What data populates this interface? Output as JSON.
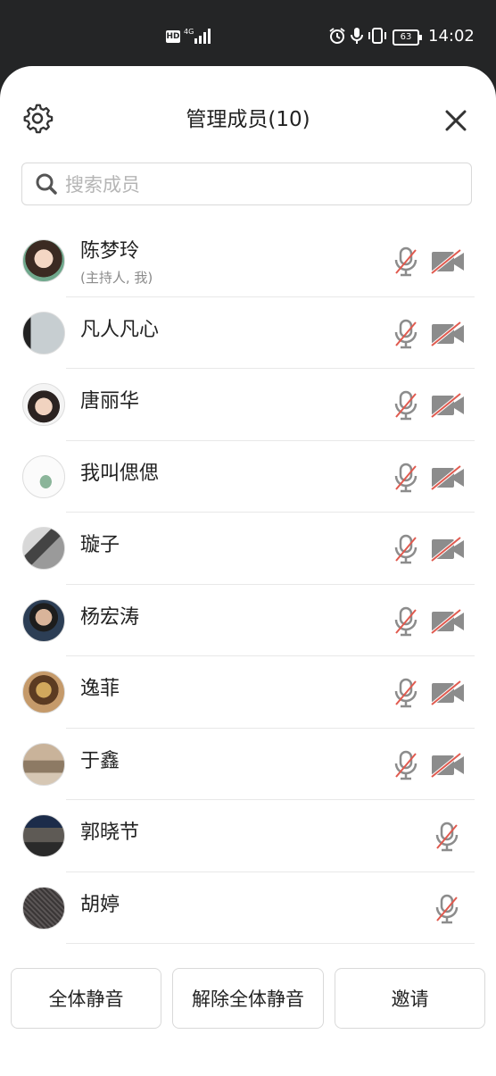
{
  "status_bar": {
    "hd": "HD",
    "network": "4G",
    "battery": "63",
    "time": "14:02"
  },
  "header": {
    "title": "管理成员(10)"
  },
  "search": {
    "placeholder": "搜索成员"
  },
  "members": [
    {
      "name": "陈梦玲",
      "role": "(主持人, 我)",
      "mic": "muted",
      "camera": "off"
    },
    {
      "name": "凡人凡心",
      "mic": "muted",
      "camera": "off"
    },
    {
      "name": "唐丽华",
      "mic": "muted",
      "camera": "off"
    },
    {
      "name": "我叫偲偲",
      "mic": "muted",
      "camera": "off"
    },
    {
      "name": "璇子",
      "mic": "muted",
      "camera": "off"
    },
    {
      "name": "杨宏涛",
      "mic": "muted",
      "camera": "off"
    },
    {
      "name": "逸菲",
      "mic": "muted",
      "camera": "off"
    },
    {
      "name": "于鑫",
      "mic": "muted",
      "camera": "off"
    },
    {
      "name": "郭晓节",
      "mic": "muted"
    },
    {
      "name": "胡婷",
      "mic": "muted"
    }
  ],
  "actions": {
    "mute_all": "全体静音",
    "unmute_all": "解除全体静音",
    "invite": "邀请"
  },
  "colors": {
    "muted_slash": "#e05a4f",
    "icon_gray": "#8c8c8c",
    "text": "#222222"
  },
  "icons": {
    "settings": "gear-icon",
    "close": "close-icon",
    "search": "search-icon",
    "mic": "mic-muted-icon",
    "camera": "camera-off-icon"
  }
}
